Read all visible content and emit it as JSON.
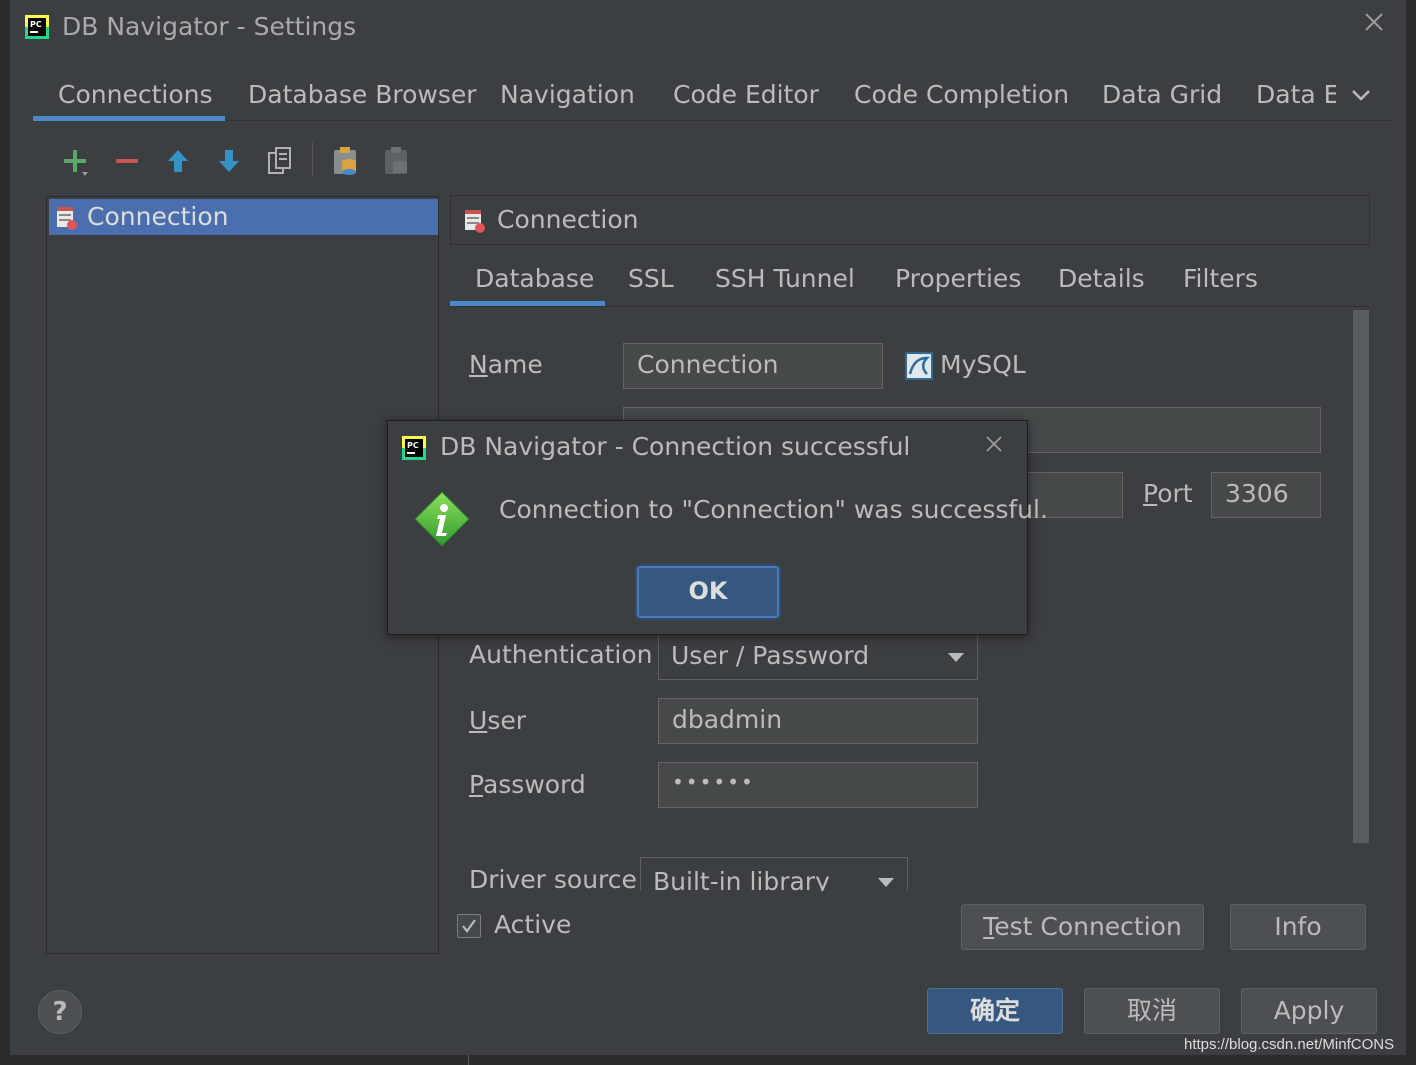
{
  "window": {
    "title": "DB Navigator - Settings"
  },
  "top_tabs": [
    {
      "label": "Connections"
    },
    {
      "label": "Database Browser"
    },
    {
      "label": "Navigation"
    },
    {
      "label": "Code Editor"
    },
    {
      "label": "Code Completion"
    },
    {
      "label": "Data Grid"
    },
    {
      "label": "Data E"
    }
  ],
  "toolbar": {
    "icons": [
      "add-icon",
      "remove-icon",
      "move-up-icon",
      "move-down-icon",
      "copy-icon",
      "paste-icon",
      "clipboard-icon"
    ]
  },
  "connection_list": {
    "items": [
      {
        "label": "Connection",
        "selected": true
      }
    ]
  },
  "detail": {
    "header": "Connection",
    "sub_tabs": [
      {
        "label": "Database"
      },
      {
        "label": "SSL"
      },
      {
        "label": "SSH Tunnel"
      },
      {
        "label": "Properties"
      },
      {
        "label": "Details"
      },
      {
        "label": "Filters"
      }
    ],
    "form": {
      "name_label_first": "N",
      "name_label_rest": "ame",
      "name_value": "Connection",
      "db_type": "MySQL",
      "port_label_first": "P",
      "port_label_rest": "ort",
      "port_value": "3306",
      "auth_label": "Authentication",
      "auth_value": "User / Password",
      "user_label_first": "U",
      "user_label_rest": "ser",
      "user_value": "dbadmin",
      "password_label_first": "P",
      "password_label_rest": "assword",
      "password_value": "••••••",
      "driver_label": "Driver source",
      "driver_value": "Built-in library"
    },
    "active_label": "Active",
    "active_checked": true,
    "test_connection_first": "T",
    "test_connection_rest": "est Connection",
    "info_label": "Info"
  },
  "footer": {
    "help_label": "?",
    "ok_label": "确定",
    "cancel_label": "取消",
    "apply_label": "Apply"
  },
  "dialog": {
    "title": "DB Navigator - Connection successful",
    "message": "Connection to \"Connection\" was successful.",
    "ok_label": "OK"
  },
  "watermark": "https://blog.csdn.net/MinfCONS",
  "colors": {
    "accent": "#4a88c7",
    "selection": "#4b6eaf",
    "primary_button": "#365880",
    "add_green": "#59a869",
    "remove_red": "#c75450",
    "arrow_blue": "#3592c4"
  }
}
